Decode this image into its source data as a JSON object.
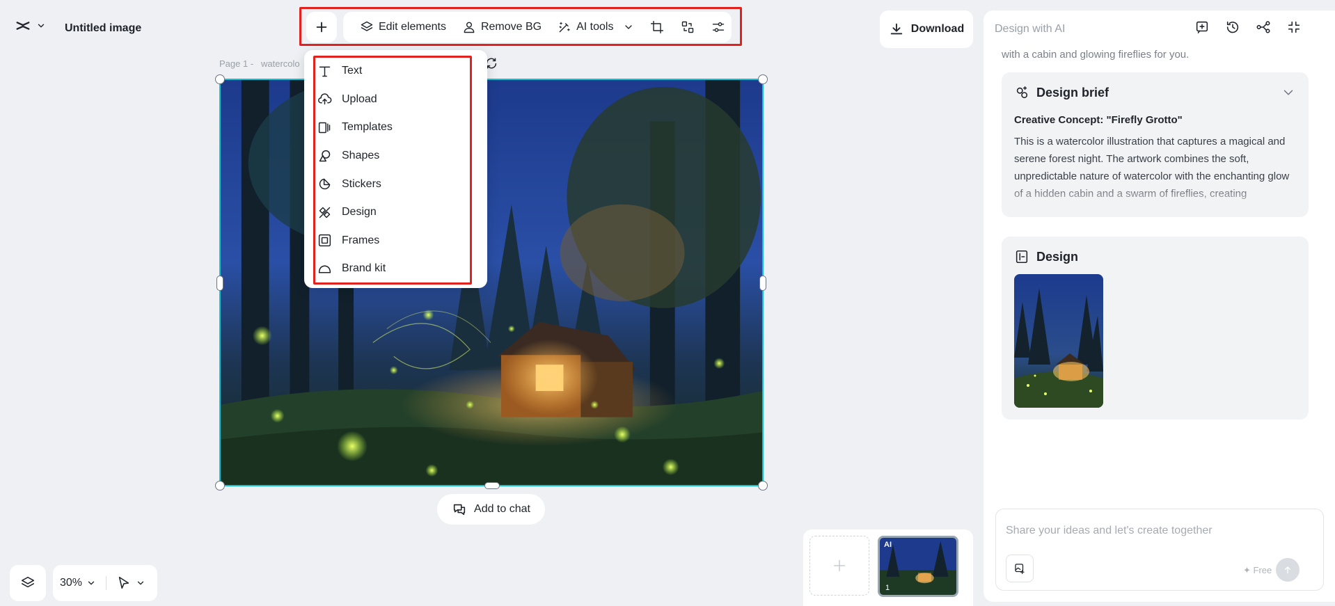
{
  "header": {
    "title": "Untitled image"
  },
  "toolbar": {
    "edit_elements": "Edit elements",
    "remove_bg": "Remove BG",
    "ai_tools": "AI tools"
  },
  "download_label": "Download",
  "canvas": {
    "page_label": "Page 1 -   watercolo"
  },
  "insert_menu": {
    "items": [
      {
        "label": "Text",
        "icon": "text-icon"
      },
      {
        "label": "Upload",
        "icon": "upload-icon"
      },
      {
        "label": "Templates",
        "icon": "templates-icon"
      },
      {
        "label": "Shapes",
        "icon": "shapes-icon"
      },
      {
        "label": "Stickers",
        "icon": "stickers-icon"
      },
      {
        "label": "Design",
        "icon": "design-icon"
      },
      {
        "label": "Frames",
        "icon": "frames-icon"
      },
      {
        "label": "Brand kit",
        "icon": "brand-kit-icon"
      }
    ]
  },
  "add_to_chat": "Add to chat",
  "zoom": "30%",
  "pages": {
    "badge": "AI",
    "number": "1"
  },
  "panel": {
    "title": "Design with AI",
    "faded_text": "with a cabin and glowing fireflies for you.",
    "brief": {
      "title": "Design brief",
      "concept": "Creative Concept: \"Firefly Grotto\"",
      "text": "This is a watercolor illustration that captures a magical and serene forest night. The artwork combines the soft, unpredictable nature of watercolor with the enchanting glow of a hidden cabin and a swarm of fireflies, creating"
    },
    "design": {
      "title": "Design"
    },
    "chat": {
      "placeholder": "Share your ideas and let's create together",
      "free": "✦ Free"
    }
  },
  "colors": {
    "highlight_red": "#e2221f",
    "selection_cyan": "#16c1d6",
    "background": "#eef0f3"
  }
}
